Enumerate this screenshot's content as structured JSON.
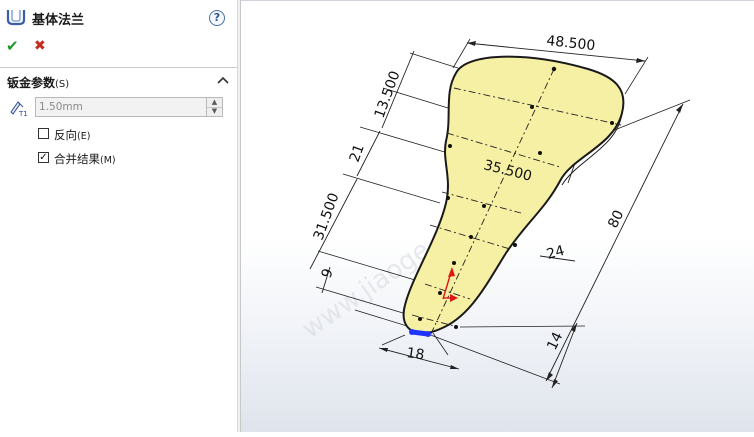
{
  "panel": {
    "title": "基体法兰",
    "help_label": "?",
    "ok_symbol": "✔",
    "cancel_symbol": "✖"
  },
  "section": {
    "title": "钣金参数",
    "accel": "(S)",
    "thickness_value": "1.50mm",
    "reverse_label": "反向",
    "reverse_accel": "(E)",
    "reverse_checked": false,
    "merge_label": "合并结果",
    "merge_accel": "(M)",
    "merge_checked": true
  },
  "sketch": {
    "dim_top_width": "48.500",
    "dim_13_5": "13.500",
    "dim_35_5": "35.500",
    "dim_21": "21",
    "dim_31_5": "31.500",
    "dim_24": "24",
    "dim_80": "80",
    "dim_9": "9",
    "dim_18": "18",
    "dim_14": "14",
    "colors": {
      "face_fill": "#f6f0a4",
      "outline": "#1a1a1a",
      "dimension": "#222222",
      "axis_red": "#e01515",
      "selection_blue": "#1f35ff"
    }
  },
  "watermark": "www.jiaoge.com"
}
